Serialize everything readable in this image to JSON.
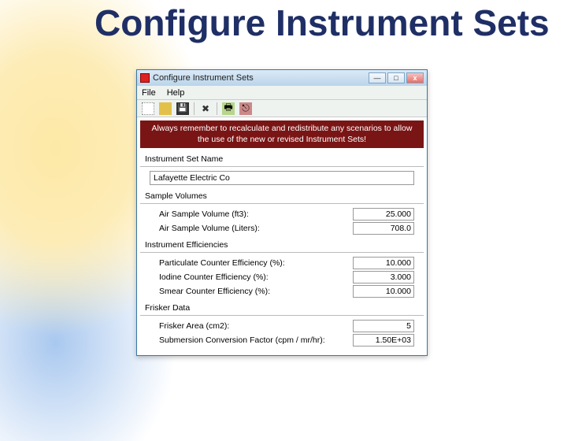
{
  "slide": {
    "title": "Configure Instrument Sets"
  },
  "window": {
    "title": "Configure Instrument Sets"
  },
  "menu": {
    "file": "File",
    "help": "Help"
  },
  "warning": "Always remember to recalculate and redistribute any scenarios to allow the use of the new or revised Instrument Sets!",
  "sections": {
    "name": {
      "label": "Instrument Set Name",
      "value": "Lafayette Electric Co"
    },
    "sample": {
      "label": "Sample Volumes",
      "air_ft3": {
        "label": "Air Sample Volume (ft3):",
        "value": "25.000"
      },
      "air_l": {
        "label": "Air Sample Volume (Liters):",
        "value": "708.0"
      }
    },
    "eff": {
      "label": "Instrument Efficiencies",
      "part": {
        "label": "Particulate Counter Efficiency (%):",
        "value": "10.000"
      },
      "iodine": {
        "label": "Iodine Counter Efficiency (%):",
        "value": "3.000"
      },
      "smear": {
        "label": "Smear Counter Efficiency (%):",
        "value": "10.000"
      }
    },
    "frisker": {
      "label": "Frisker Data",
      "area": {
        "label": "Frisker Area (cm2):",
        "value": "5"
      },
      "scf": {
        "label": "Submersion Conversion Factor (cpm / mr/hr):",
        "value": "1.50E+03"
      }
    }
  }
}
